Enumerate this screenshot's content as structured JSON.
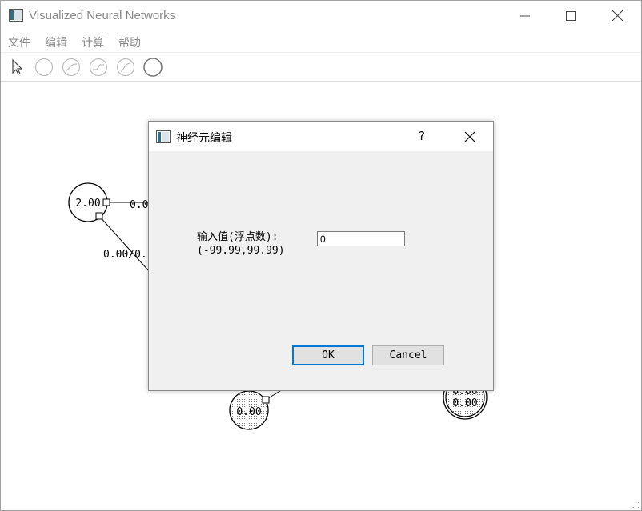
{
  "window": {
    "title": "Visualized Neural Networks"
  },
  "menubar": {
    "items": [
      "文件",
      "编辑",
      "计算",
      "帮助"
    ]
  },
  "toolbar": {
    "tools": [
      "pointer-tool",
      "neuron-tool",
      "sigmoid-neuron-tool",
      "tanh-neuron-tool",
      "step-neuron-tool",
      "output-neuron-tool"
    ]
  },
  "canvas": {
    "neurons": [
      {
        "label": "2.00"
      },
      {
        "label": "0.00"
      },
      {
        "label": "0.00"
      },
      {
        "label": "0.00"
      }
    ],
    "edges": [
      {
        "label": "0.0"
      },
      {
        "label": "0.00/0."
      }
    ]
  },
  "dialog": {
    "title": "神经元编辑",
    "help_label": "?",
    "field_label_line1": "输入值(浮点数):",
    "field_label_line2": "(-99.99,99.99)",
    "input_value": "0",
    "ok_label": "OK",
    "cancel_label": "Cancel"
  }
}
